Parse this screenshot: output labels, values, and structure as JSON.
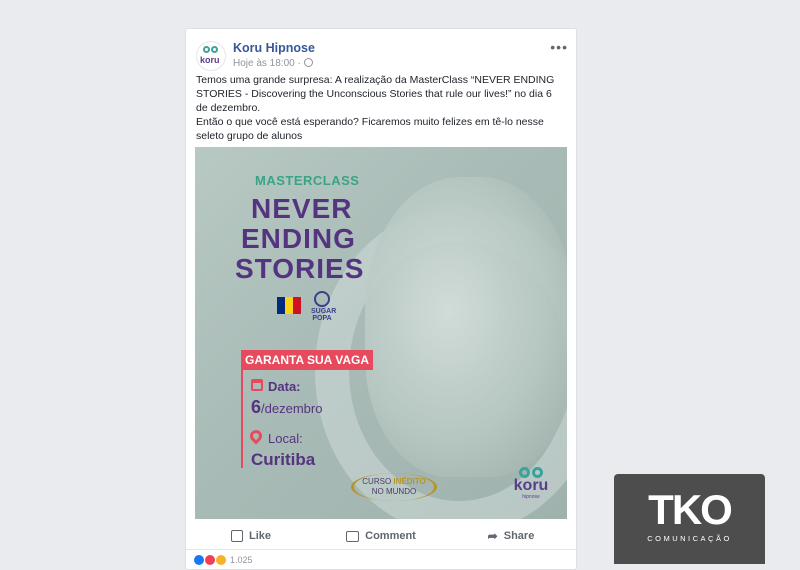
{
  "post": {
    "page_name": "Koru Hipnose",
    "timestamp": "Hoje  às 18:00 ·",
    "more_icon": "more-dots-icon",
    "text_line1": "Temos uma grande surpresa: A realização da MasterClass “NEVER ENDING STORIES - Discovering the Unconscious Stories that rule our lives!” no dia 6 de dezembro.",
    "text_line2": "Então o que você está esperando? Ficaremos muito felizes em tê-lo nesse seleto grupo de alunos"
  },
  "avatar": {
    "logo_text": "koru"
  },
  "promo": {
    "kicker": "MASTERCLASS",
    "title_1": "NEVER",
    "title_2": "ENDING",
    "title_3": "STORIES",
    "cta": "GARANTA SUA VAGA",
    "date_label": "Data:",
    "date_day": "6",
    "date_month": "/dezembro",
    "place_label": "Local:",
    "place_value": "Curitiba",
    "badge_line1_a": "CURSO ",
    "badge_line1_b": "INÉDITO",
    "badge_line2": "NO MUNDO",
    "sugar_name": "SUGAR POPA",
    "logo_word": "koru",
    "logo_sub": "hipnose",
    "flag_colors": [
      "#002b7f",
      "#fcd116",
      "#ce1126"
    ]
  },
  "actions": {
    "like": "Like",
    "comment": "Comment",
    "share": "Share"
  },
  "reactions": {
    "count": "1.025"
  },
  "watermark": {
    "mark": "TKO",
    "sub": "COMUNICAÇÃO"
  },
  "colors": {
    "accent_purple": "#55347f",
    "accent_teal": "#3aa386",
    "accent_red": "#e64a5c",
    "facebook_blue": "#365899"
  }
}
